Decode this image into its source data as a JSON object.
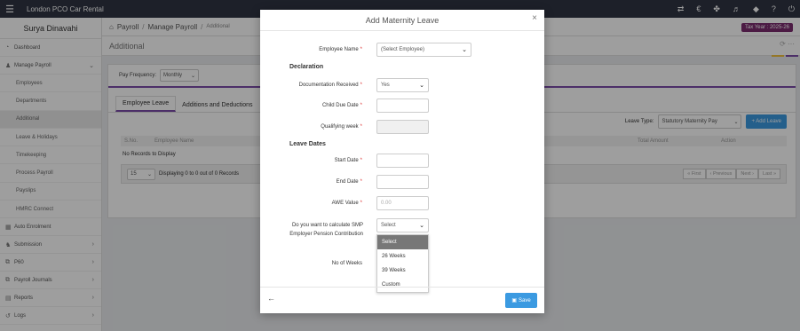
{
  "app": {
    "title": "London PCO Car Rental",
    "tax_year": "Tax Year : 2025-26"
  },
  "topbar_icons": [
    "transfer-icon",
    "credit-icon",
    "share-icon",
    "bell-icon",
    "tag-icon",
    "help-icon",
    "power-icon"
  ],
  "sidebar": {
    "user": "Surya Dinavahi",
    "dashboard": "Dashboard",
    "manage_payroll": "Manage Payroll",
    "sub_items": [
      "Employees",
      "Departments",
      "Additional",
      "Leave & Holidays",
      "Timekeeping",
      "Process Payroll",
      "Payslips",
      "HMRC Connect"
    ],
    "auto_enrolment": "Auto Enrolment",
    "submission": "Submission",
    "p60": "P60",
    "payroll_journals": "Payroll Journals",
    "reports": "Reports",
    "logs": "Logs"
  },
  "breadcrumb": {
    "part1": "Payroll",
    "part2": "Manage Payroll",
    "part3": "Additional"
  },
  "section_title": "Additional",
  "pay_frequency": {
    "label": "Pay Frequency:",
    "value": "Monthly"
  },
  "tabs": [
    "Employee Leave",
    "Additions and Deductions"
  ],
  "leave_type": {
    "label": "Leave Type:",
    "value": "Statutory Maternity Pay"
  },
  "add_leave_label": "+ Add Leave",
  "table": {
    "headers": [
      "S.No.",
      "Employee Name",
      "Total Amount",
      "Action"
    ],
    "no_records": "No Records to Display"
  },
  "pager": {
    "page_size": "15",
    "info": "Displaying 0 to 0 out of 0 Records",
    "buttons": [
      "« First",
      "‹ Previous",
      "Next ›",
      "Last »"
    ]
  },
  "modal": {
    "title": "Add Maternity Leave",
    "close": "×",
    "employee_name_label": "Employee Name",
    "employee_name_value": "(Select Employee)",
    "declaration": "Declaration",
    "doc_received_label": "Documentation Received",
    "doc_received_value": "Yes",
    "child_due_label": "Child Due Date",
    "qualifying_week_label": "Qualifying week",
    "leave_dates": "Leave Dates",
    "start_date_label": "Start Date",
    "end_date_label": "End Date",
    "awe_label": "AWE Value",
    "awe_placeholder": "0.00",
    "smp_label": "Do you want to calculate SMP Employer Pension Contribution",
    "smp_value": "Select",
    "weeks_label": "No of Weeks",
    "dropdown_options": [
      "Select",
      "26 Weeks",
      "39 Weeks",
      "Custom"
    ],
    "save": "Save"
  }
}
